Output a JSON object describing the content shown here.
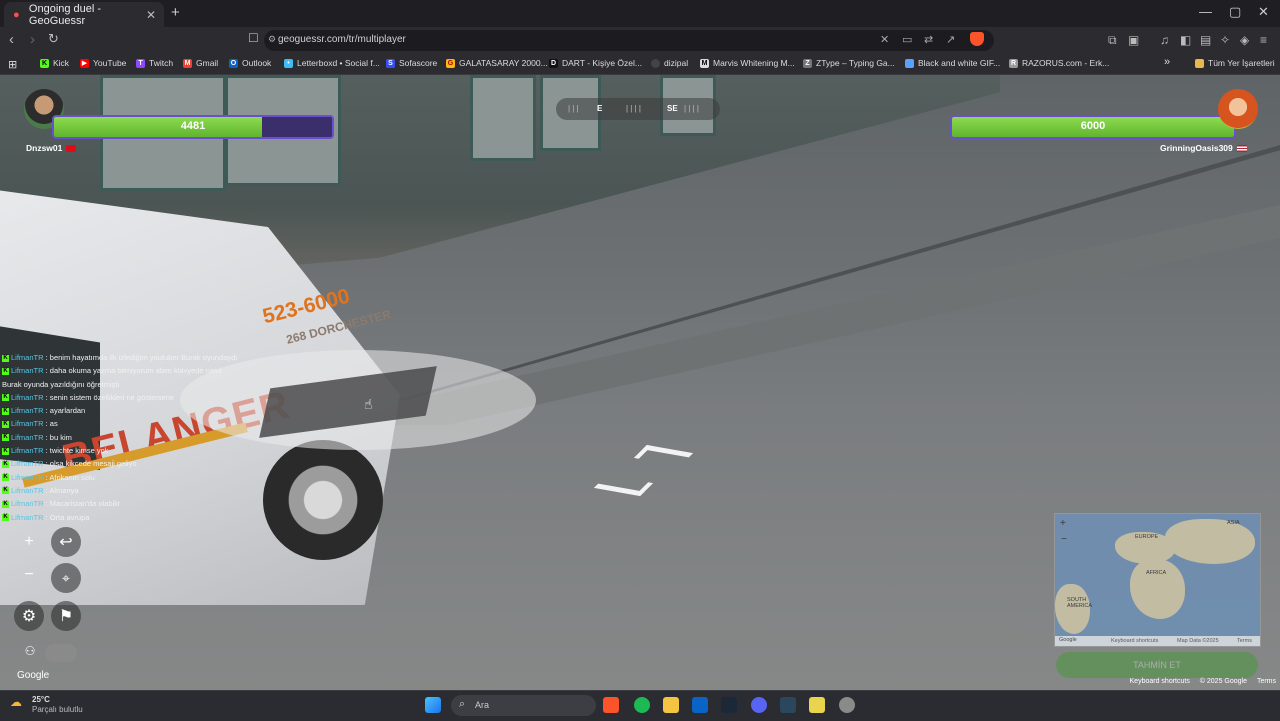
{
  "browser": {
    "tab_title": "Ongoing duel - GeoGuessr",
    "tab_close": "✕",
    "new_tab": "+",
    "url": "geoguessr.com/tr/multiplayer",
    "window_controls": [
      "—",
      "▢",
      "✕"
    ],
    "bookmarks": [
      {
        "label": "Kick",
        "icon": "kick-icon",
        "color": "#53fc18"
      },
      {
        "label": "YouTube",
        "icon": "youtube-icon",
        "color": "#ff0000"
      },
      {
        "label": "Twitch",
        "icon": "twitch-icon",
        "color": "#9146ff"
      },
      {
        "label": "Gmail",
        "icon": "gmail-icon",
        "color": "#ea4335"
      },
      {
        "label": "Outlook",
        "icon": "outlook-icon",
        "color": "#0a64c8"
      },
      {
        "label": "Letterboxd • Social f...",
        "icon": "letterboxd-icon",
        "color": "#40bcf4"
      },
      {
        "label": "Sofascore",
        "icon": "sofascore-icon",
        "color": "#374df5"
      },
      {
        "label": "GALATASARAY 2000...",
        "icon": "galatasaray-icon",
        "color": "#fdb912"
      },
      {
        "label": "DART - Kişiye Özel...",
        "icon": "dart-icon",
        "color": "#111111"
      },
      {
        "label": "dizipal",
        "icon": "dizipal-icon",
        "color": "#444444"
      },
      {
        "label": "Marvis Whitening M...",
        "icon": "marvis-icon",
        "color": "#dddddd"
      },
      {
        "label": "ZType – Typing Ga...",
        "icon": "ztype-icon",
        "color": "#777777"
      },
      {
        "label": "Black and white GIF...",
        "icon": "gif-icon",
        "color": "#5aa0ff"
      },
      {
        "label": "RAZORUS.com - Erk...",
        "icon": "razorus-icon",
        "color": "#999999"
      }
    ],
    "bookmarks_more": "»",
    "all_bookmarks": "Tüm Yer İşaretleri"
  },
  "game": {
    "compass": {
      "e": "E",
      "se": "SE"
    },
    "player1": {
      "name": "Dnzsw01",
      "health": 4481,
      "health_max": 6000,
      "flag": "turkey-flag"
    },
    "player2": {
      "name": "GrinningOasis309",
      "health": 6000,
      "health_max": 6000,
      "flag": "usa-flag"
    },
    "truck_text": {
      "phone": "523-6000",
      "address": "268 DORCHESTER",
      "brand": "BELANGER"
    },
    "chat": [
      {
        "user": "LifmanTR",
        "text": "benim hayatımda ilk izlediğim youtuber Burak oyundaydı"
      },
      {
        "user": "LifmanTR",
        "text": "daha okuma yazma bilmiyorum abim klavyede nasıl Burak oyunda yazıldığını öğretmişti"
      },
      {
        "user": "LifmanTR",
        "text": "senin sistem özellikleri ne göstersene"
      },
      {
        "user": "LifmanTR",
        "text": "ayarlardan"
      },
      {
        "user": "LifmanTR",
        "text": "as"
      },
      {
        "user": "LifmanTR",
        "text": "bu kim"
      },
      {
        "user": "LifmanTR",
        "text": "twichte kimse yok"
      },
      {
        "user": "LifmanTR",
        "text": "olsa kikcede mesaji geliyo"
      },
      {
        "user": "LifmanTR",
        "text": "Afrikanın solu"
      },
      {
        "user": "LifmanTR",
        "text": "Almanya"
      },
      {
        "user": "LifmanTR",
        "text": "Macaristan'da olabilir"
      },
      {
        "user": "LifmanTR",
        "text": "Orta avrupa"
      }
    ],
    "controls": {
      "zoom_in": "+",
      "zoom_out": "−",
      "undo": "↩",
      "return": "⌖",
      "settings": "⚙",
      "flag": "⚑"
    },
    "google_label": "Google",
    "minimap": {
      "labels": [
        "EUROPE",
        "ASIA",
        "AFRICA",
        "SOUTH AMERICA"
      ],
      "zoom_in": "+",
      "zoom_out": "−",
      "footer": [
        "Google",
        "Keyboard shortcuts",
        "Map Data ©2025",
        "Terms"
      ]
    },
    "guess_button": "TAHMİN ET",
    "footer": [
      "Keyboard shortcuts",
      "© 2025 Google",
      "Terms"
    ]
  },
  "taskbar": {
    "weather_temp": "25°C",
    "weather_desc": "Parçalı bulutlu",
    "search_placeholder": "Ara",
    "apps": [
      {
        "icon": "windows-icon",
        "color": "#3aa0ff"
      },
      {
        "icon": "brave-icon",
        "color": "#fb542b"
      },
      {
        "icon": "spotify-icon",
        "color": "#1db954"
      },
      {
        "icon": "folder-icon",
        "color": "#f4c542"
      },
      {
        "icon": "outlook-icon",
        "color": "#0a64c8"
      },
      {
        "icon": "steam-icon",
        "color": "#1b2838"
      },
      {
        "icon": "discord-icon",
        "color": "#5865f2"
      },
      {
        "icon": "steam-icon",
        "color": "#2a475e"
      },
      {
        "icon": "app-icon",
        "color": "#e8d44d"
      },
      {
        "icon": "settings-icon",
        "color": "#8a8a8a"
      }
    ]
  }
}
